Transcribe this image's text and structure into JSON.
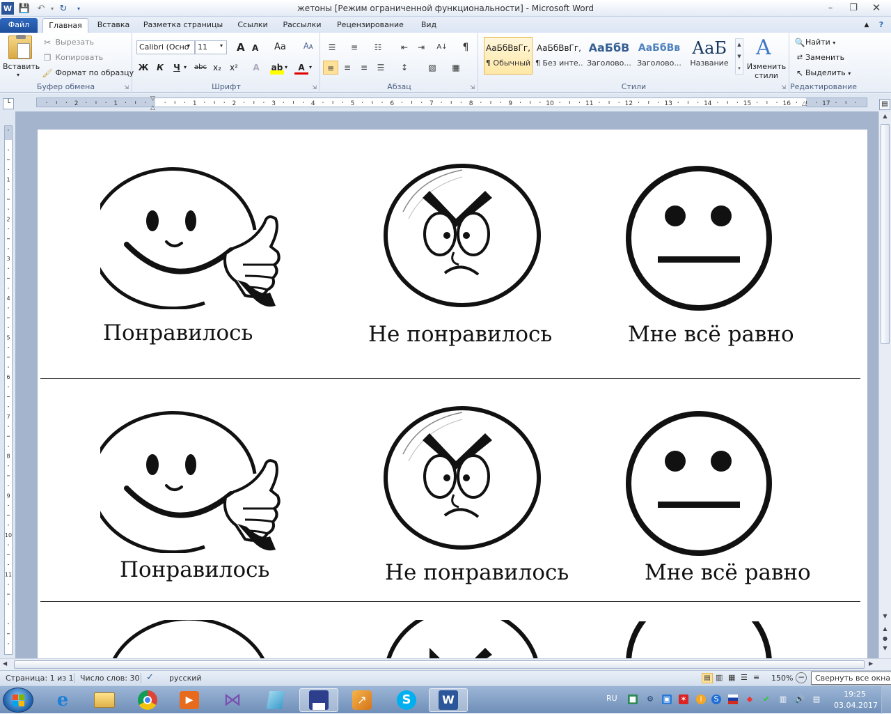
{
  "window": {
    "title": "жетоны [Режим ограниченной функциональности]  -  Microsoft Word"
  },
  "tabs": [
    "Файл",
    "Главная",
    "Вставка",
    "Разметка страницы",
    "Ссылки",
    "Рассылки",
    "Рецензирование",
    "Вид"
  ],
  "ribbon": {
    "clipboard": {
      "label": "Буфер обмена",
      "paste": "Вставить",
      "cut": "Вырезать",
      "copy": "Копировать",
      "format_painter": "Формат по образцу"
    },
    "font": {
      "label": "Шрифт",
      "font_name": "Calibri (Осно",
      "font_size": "11",
      "bold": "Ж",
      "italic": "К",
      "underline": "Ч",
      "strike": "abc",
      "subscript": "x₂",
      "superscript": "x²",
      "grow": "A",
      "shrink": "A",
      "case": "Aa",
      "color_letter": "A"
    },
    "paragraph": {
      "label": "Абзац"
    },
    "styles": {
      "label": "Стили",
      "items": [
        {
          "preview": "АаБбВвГг,",
          "name": "¶ Обычный"
        },
        {
          "preview": "АаБбВвГг,",
          "name": "¶ Без инте..."
        },
        {
          "preview": "АаБбВ",
          "name": "Заголово..."
        },
        {
          "preview": "АаБбВв",
          "name": "Заголово..."
        },
        {
          "preview": "АаБ",
          "name": "Название"
        }
      ],
      "change_styles": "Изменить стили"
    },
    "editing": {
      "label": "Редактирование",
      "find": "Найти",
      "replace": "Заменить",
      "select": "Выделить"
    }
  },
  "ruler": {
    "numbers": [
      "1",
      "2",
      "1",
      "1",
      "2",
      "3",
      "4",
      "5",
      "6",
      "7",
      "8",
      "9",
      "10",
      "11",
      "12",
      "13",
      "14",
      "15",
      "16",
      "17"
    ],
    "vnumbers": [
      "1",
      "1",
      "2",
      "3",
      "4",
      "5",
      "6",
      "7",
      "8",
      "9",
      "10",
      "11"
    ]
  },
  "document": {
    "rows": [
      {
        "captions": [
          "Понравилось",
          "Не понравилось",
          "Мне всё равно"
        ]
      },
      {
        "captions": [
          "Понравилось",
          "Не понравилось",
          "Мне всё равно"
        ]
      }
    ]
  },
  "status": {
    "page": "Страница: 1 из 1",
    "words": "Число слов: 30",
    "language": "русский",
    "zoom": "150%",
    "tooltip": "Свернуть все окна"
  },
  "taskbar": {
    "lang": "RU",
    "time": "19:25",
    "date": "03.04.2017"
  }
}
